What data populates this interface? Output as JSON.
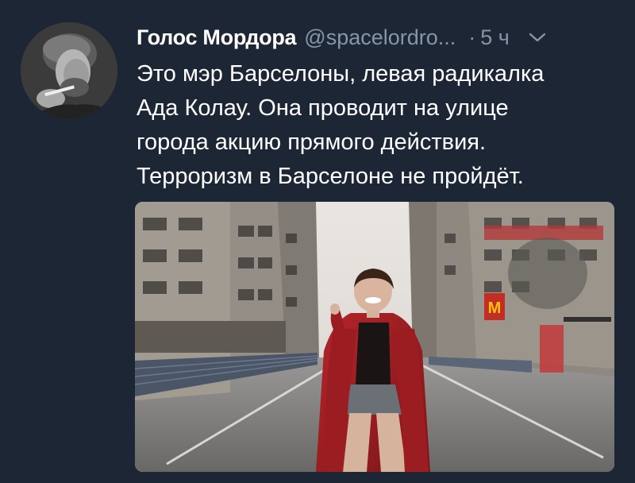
{
  "tweet": {
    "author": {
      "display_name": "Голос Мордора",
      "handle": "@spacelordro...",
      "avatar_icon": "avatar-photo"
    },
    "separator": "·",
    "timestamp": "5 ч",
    "menu_icon": "chevron-down-icon",
    "text_lines": [
      "Это мэр Барселоны, левая радикалка",
      "Ада Колау. Она проводит на улице",
      "города акцию прямого действия.",
      "Терроризм в Барселоне не пройдёт."
    ],
    "media": {
      "type": "photo",
      "sign_text": "M"
    }
  },
  "colors": {
    "background": "#1c2634",
    "text_primary": "#ffffff",
    "text_secondary": "#8596a7"
  }
}
